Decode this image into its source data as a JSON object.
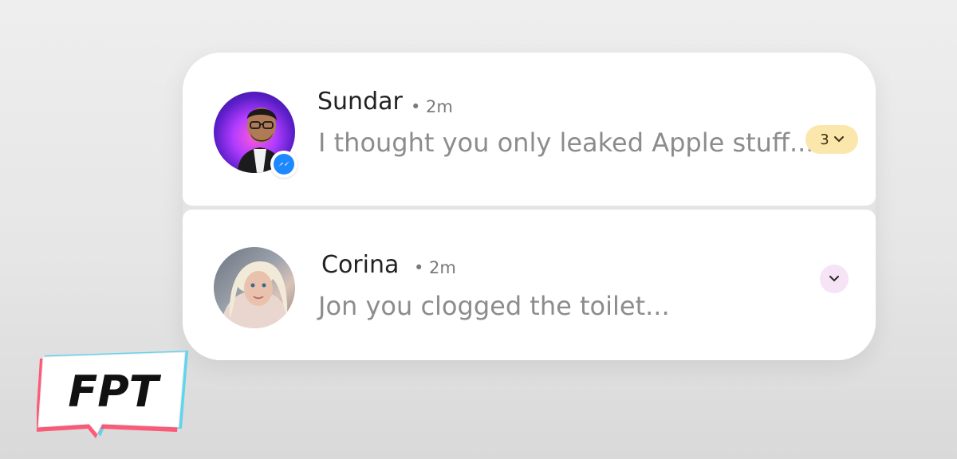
{
  "notifications": [
    {
      "name": "Sundar",
      "time": "• 2m",
      "message": "I thought you only leaked Apple stuff...",
      "count": "3",
      "app_icon": "messenger-icon",
      "count_chip_color": "#fbe6ac"
    },
    {
      "name": "Corina",
      "time": "• 2m",
      "message": "Jon you clogged the toilet...",
      "expand_chip_color": "#f6e3f6"
    }
  ],
  "watermark": {
    "text": "FPT"
  },
  "colors": {
    "messenger_blue": "#1e88ff",
    "card_background": "#ffffff",
    "message_text": "#8c8c8c"
  }
}
